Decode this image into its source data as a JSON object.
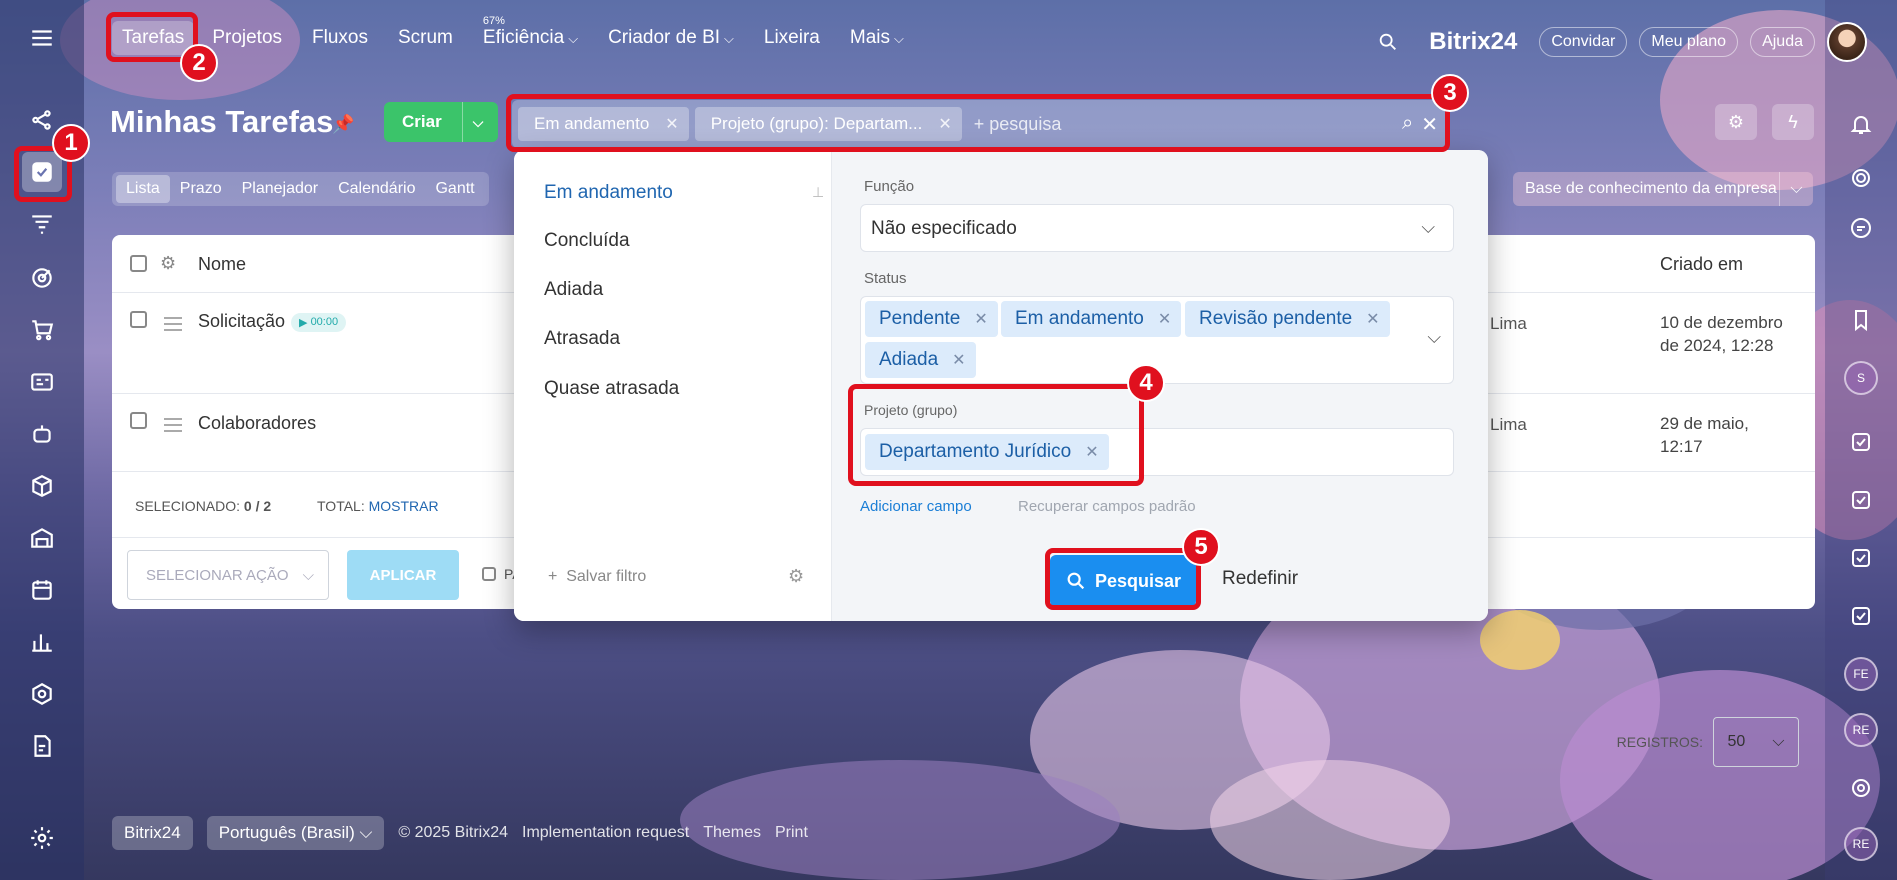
{
  "nav": {
    "items": [
      {
        "label": "Tarefas",
        "sup": ""
      },
      {
        "label": "Projetos",
        "sup": ""
      },
      {
        "label": "Fluxos",
        "sup": ""
      },
      {
        "label": "Scrum",
        "sup": ""
      },
      {
        "label": "Eficiência",
        "sup": "67%"
      },
      {
        "label": "Criador de BI",
        "sup": ""
      },
      {
        "label": "Lixeira",
        "sup": ""
      },
      {
        "label": "Mais",
        "sup": ""
      }
    ],
    "logo": "Bitrix24",
    "invite": "Convidar",
    "plan": "Meu plano",
    "help": "Ajuda"
  },
  "page": {
    "title": "Minhas Tarefas",
    "create_label": "Criar",
    "filter_chips": [
      "Em andamento",
      "Projeto (grupo): Departam..."
    ],
    "search_placeholder": "+ pesquisa",
    "view_tabs": [
      "Lista",
      "Prazo",
      "Planejador",
      "Calendário",
      "Gantt"
    ],
    "knowledge_base": "Base de conhecimento da empresa"
  },
  "grid": {
    "col_name": "Nome",
    "col_created": "Criado em",
    "rows": [
      {
        "name": "Solicitação",
        "timer": "00:00",
        "person": "Lima",
        "created": "10 de dezembro de 2024, 12:28"
      },
      {
        "name": "Colaboradores",
        "timer": "",
        "person": "Lima",
        "created": "29 de maio, 12:17"
      }
    ],
    "selected_label": "SELECIONADO:",
    "selected_value": "0 / 2",
    "total_label": "TOTAL:",
    "total_value": "MOSTRAR",
    "records_label": "REGISTROS:",
    "records_value": "50",
    "select_action": "SELECIONAR AÇÃO",
    "apply": "APLICAR",
    "trailing_checkbox_label": "PA"
  },
  "filter_popup": {
    "presets": [
      "Em andamento",
      "Concluída",
      "Adiada",
      "Atrasada",
      "Quase atrasada"
    ],
    "save_filter": "Salvar filtro",
    "funcao_label": "Função",
    "funcao_value": "Não especificado",
    "status_label": "Status",
    "status_tags": [
      "Pendente",
      "Em andamento",
      "Revisão pendente",
      "Adiada"
    ],
    "project_label": "Projeto (grupo)",
    "project_tag": "Departamento Jurídico",
    "add_field": "Adicionar campo",
    "restore_fields": "Recuperar campos padrão",
    "search_button": "Pesquisar",
    "reset_button": "Redefinir"
  },
  "footer": {
    "brand": "Bitrix24",
    "language": "Português (Brasil)",
    "copyright": "© 2025 Bitrix24",
    "links": [
      "Implementation request",
      "Themes",
      "Print"
    ]
  },
  "right_avatars": [
    "S",
    "FE",
    "RE",
    "RE"
  ],
  "annotations": [
    "1",
    "2",
    "3",
    "4",
    "5"
  ],
  "colors": {
    "highlight": "#e0101e",
    "primary": "#1a8ef0",
    "create": "#3bc46a",
    "tag_bg": "#dcebfb"
  }
}
